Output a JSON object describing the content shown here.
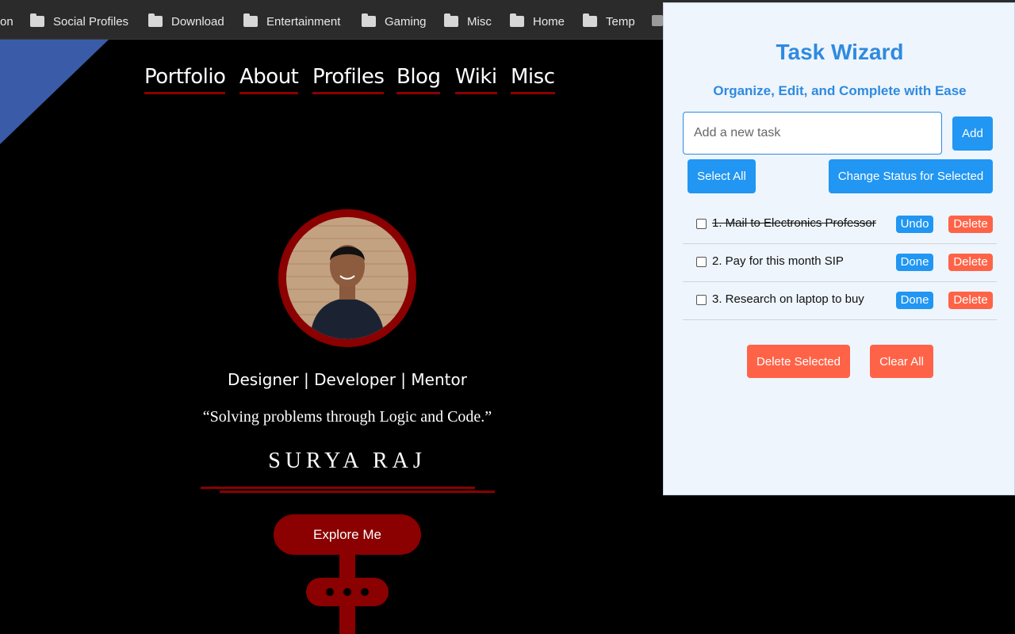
{
  "bookmarks": {
    "cut_label": "on",
    "items": [
      {
        "label": "Social Profiles",
        "icon": "folder-icon"
      },
      {
        "label": "Download",
        "icon": "folder-icon"
      },
      {
        "label": "Entertainment",
        "icon": "folder-icon"
      },
      {
        "label": "Gaming",
        "icon": "folder-icon"
      },
      {
        "label": "Misc",
        "icon": "folder-icon"
      },
      {
        "label": "Home",
        "icon": "folder-icon"
      },
      {
        "label": "Temp",
        "icon": "folder-icon"
      }
    ]
  },
  "site": {
    "nav": [
      "Portfolio",
      "About",
      "Profiles",
      "Blog",
      "Wiki",
      "Misc"
    ],
    "roles": "Designer | Developer | Mentor",
    "quote": "“Solving problems through Logic and Code.”",
    "name": "SURYA RAJ",
    "explore_label": "Explore Me",
    "colors": {
      "accent": "#8b0000",
      "corner": "#3a5ba8",
      "background": "#000000"
    }
  },
  "popup": {
    "title": "Task Wizard",
    "subtitle": "Organize, Edit, and Complete with Ease",
    "input_placeholder": "Add a new task",
    "input_value": "",
    "add_label": "Add",
    "select_all_label": "Select All",
    "change_status_label": "Change Status for Selected",
    "tasks": [
      {
        "text": "1. Mail to Electronics Professor",
        "completed": true,
        "checked": false,
        "toggle_label": "Undo",
        "delete_label": "Delete"
      },
      {
        "text": "2. Pay for this month SIP",
        "completed": false,
        "checked": false,
        "toggle_label": "Done",
        "delete_label": "Delete"
      },
      {
        "text": "3. Research on laptop to buy",
        "completed": false,
        "checked": false,
        "toggle_label": "Done",
        "delete_label": "Delete"
      }
    ],
    "delete_selected_label": "Delete Selected",
    "clear_all_label": "Clear All",
    "colors": {
      "primary": "#2196f3",
      "danger": "#ff6347",
      "title": "#2f8ae0",
      "background": "#eef5fd"
    }
  }
}
